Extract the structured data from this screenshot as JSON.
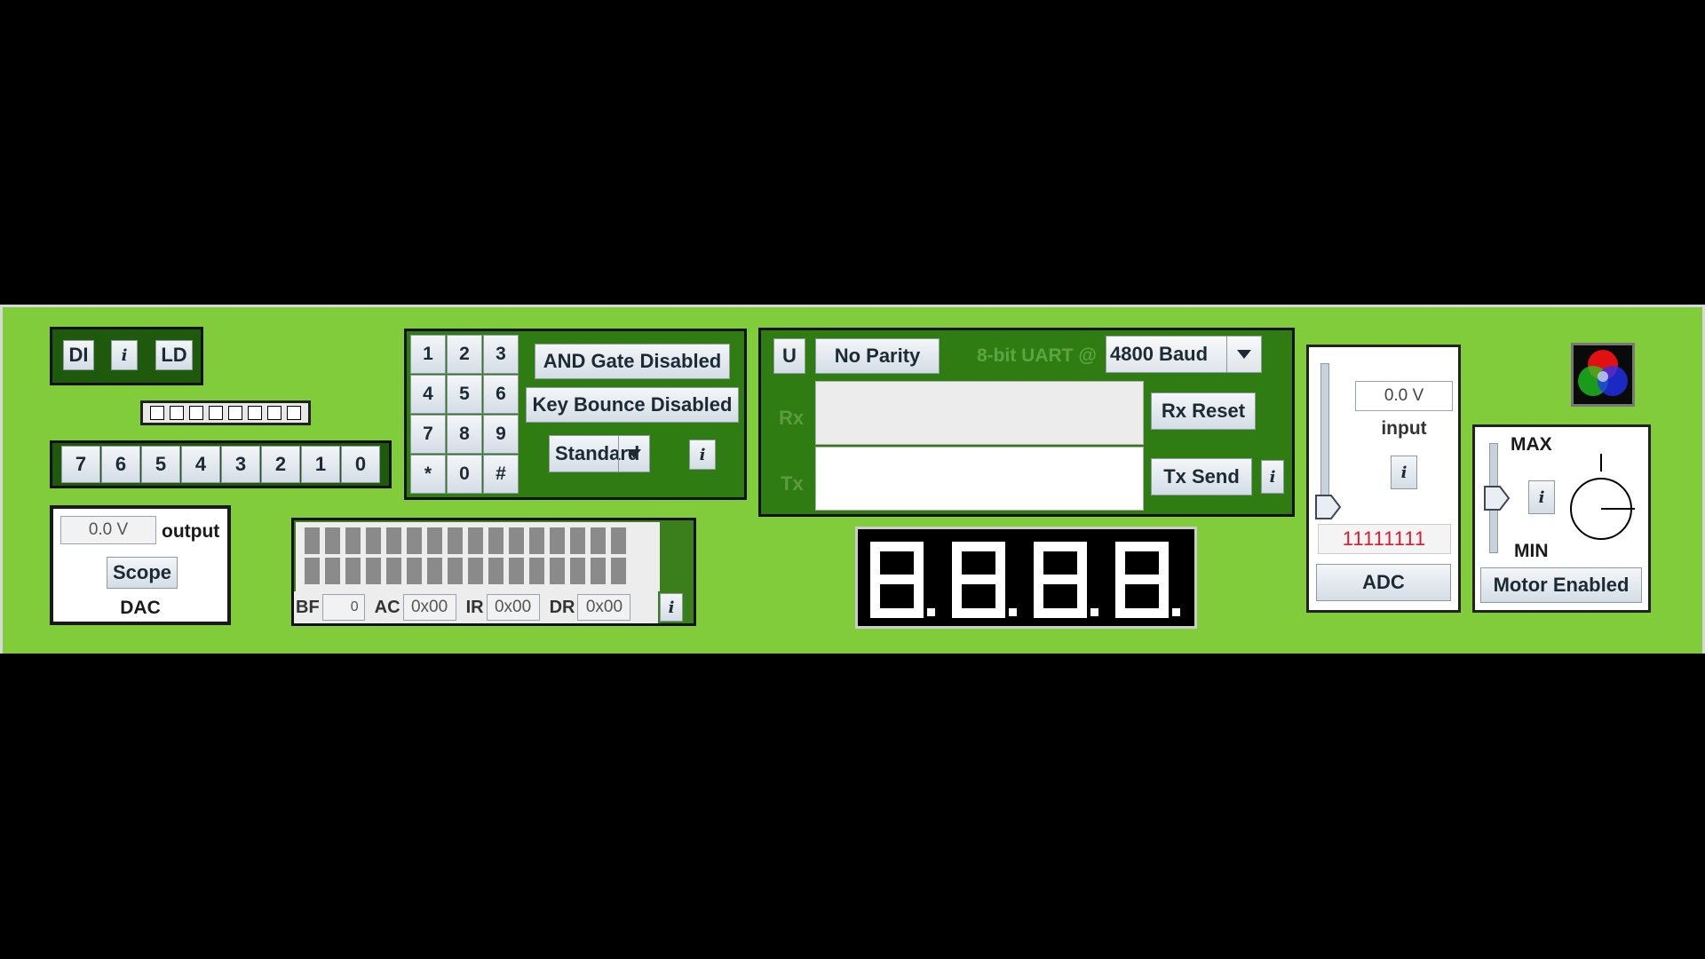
{
  "io": {
    "di_label": "DI",
    "info_label": "i",
    "ld_label": "LD",
    "switches": [
      "7",
      "6",
      "5",
      "4",
      "3",
      "2",
      "1",
      "0"
    ]
  },
  "dac": {
    "value": "0.0 V",
    "output_label": "output",
    "scope_label": "Scope",
    "title": "DAC"
  },
  "keypad": {
    "keys": [
      "1",
      "2",
      "3",
      "4",
      "5",
      "6",
      "7",
      "8",
      "9",
      "*",
      "0",
      "#"
    ],
    "and_gate_label": "AND Gate Disabled",
    "key_bounce_label": "Key Bounce Disabled",
    "mode_selected": "Standard",
    "info_label": "i"
  },
  "lcd": {
    "bf_label": "BF",
    "bf_value": "0",
    "ac_label": "AC",
    "ac_value": "0x00",
    "ir_label": "IR",
    "ir_value": "0x00",
    "dr_label": "DR",
    "dr_value": "0x00",
    "info_label": "i"
  },
  "uart": {
    "u_label": "U",
    "parity_label": "No Parity",
    "title": "8-bit UART @",
    "baud_selected": "4800 Baud",
    "rx_label": "Rx",
    "tx_label": "Tx",
    "rx_text": "",
    "tx_text": "",
    "rx_reset_label": "Rx Reset",
    "tx_send_label": "Tx Send",
    "info_label": "i"
  },
  "seven_segment": {
    "digits": "8888"
  },
  "adc": {
    "value": "0.0 V",
    "input_label": "input",
    "info_label": "i",
    "binary_value": "11111111",
    "button_label": "ADC",
    "slider_level": 0
  },
  "motor": {
    "max_label": "MAX",
    "min_label": "MIN",
    "info_label": "i",
    "button_label": "Motor Enabled",
    "slider_level": 0.5
  },
  "colors": {
    "board": "#80cc3a",
    "panel_dark": "#2f7d12",
    "binary_text": "#e0182d"
  },
  "icons": {
    "rgb_led": "rgb-led-icon",
    "dropdown": "chevron-down-icon",
    "motor_dial": "motor-dial-icon",
    "slider_thumb": "slider-thumb-icon"
  }
}
